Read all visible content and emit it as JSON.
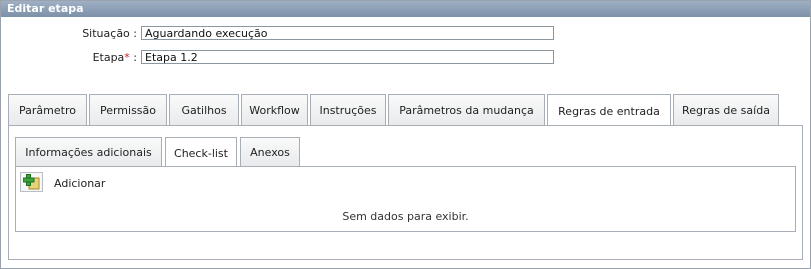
{
  "title": "Editar etapa",
  "fields": {
    "situacao": {
      "label": "Situação",
      "value": "Aguardando execução"
    },
    "etapa": {
      "label": "Etapa",
      "required": "*",
      "value": "Etapa 1.2"
    }
  },
  "tabs": [
    {
      "label": "Parâmetro"
    },
    {
      "label": "Permissão"
    },
    {
      "label": "Gatilhos"
    },
    {
      "label": "Workflow"
    },
    {
      "label": "Instruções"
    },
    {
      "label": "Parâmetros da mudança"
    },
    {
      "label": "Regras de entrada",
      "active": true
    },
    {
      "label": "Regras de saída"
    }
  ],
  "subtabs": [
    {
      "label": "Informações adicionais"
    },
    {
      "label": "Check-list",
      "active": true
    },
    {
      "label": "Anexos"
    }
  ],
  "actions": {
    "add_label": "Adicionar",
    "add_icon": "add-document-icon"
  },
  "empty_message": "Sem dados para exibir."
}
